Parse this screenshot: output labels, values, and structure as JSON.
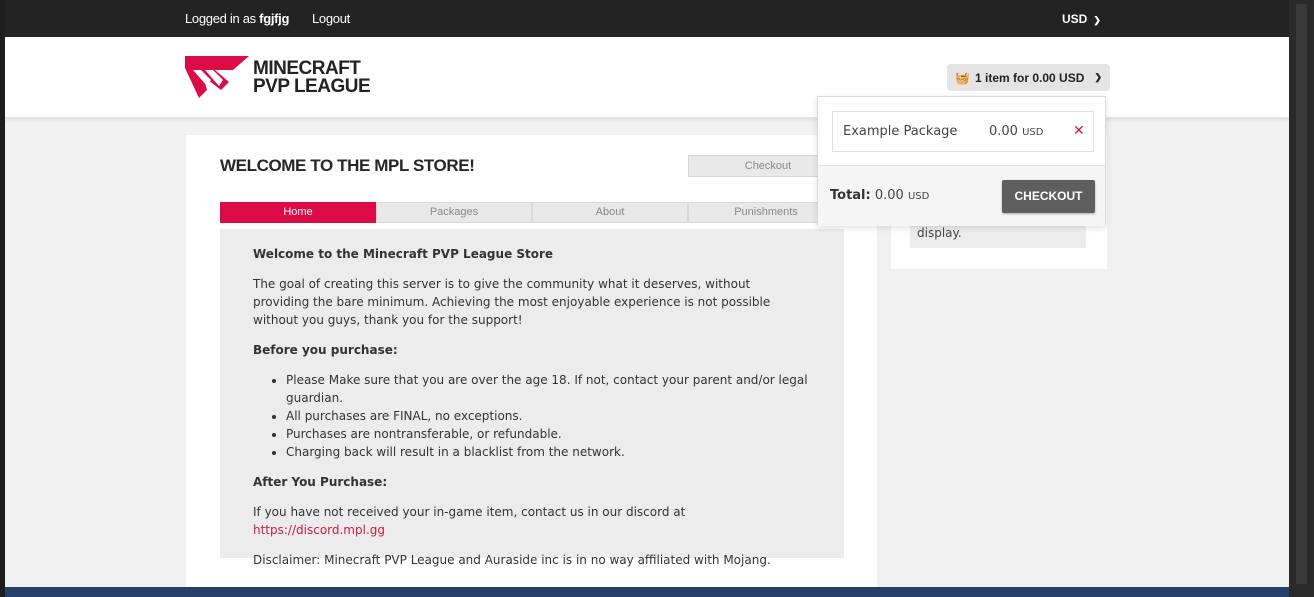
{
  "topbar": {
    "logged_in_prefix": "Logged in as",
    "username": "fgjfjg",
    "logout": "Logout",
    "currency": "USD"
  },
  "header": {
    "logo_line1": "MINECRAFT",
    "logo_line2": "PVP LEAGUE",
    "cart_button": "1 item for 0.00 USD"
  },
  "main": {
    "title": "WELCOME TO THE MPL STORE!",
    "checkout_button": "Checkout",
    "tabs": [
      {
        "label": "Home"
      },
      {
        "label": "Packages"
      },
      {
        "label": "About"
      },
      {
        "label": "Punishments"
      }
    ],
    "content": {
      "heading": "Welcome to the Minecraft PVP League Store",
      "intro_line1": "The goal of creating this server is to give the community what it deserves, without",
      "intro_line2": "providing the bare minimum. Achieving the most enjoyable experience is not possible without you guys, thank you for the support!",
      "before_heading": "Before you purchase:",
      "rules": [
        "Please Make sure that you are over the age 18. If not, contact your parent and/or legal guardian.",
        "All purchases are FINAL, no exceptions.",
        "Purchases are nontransferable, or refundable.",
        "Charging back will result in a blacklist from the network."
      ],
      "after_heading": "After You Purchase:",
      "after_text": "If you have not received your in-game item, contact us in our discord at",
      "discord_link": "https://discord.mpl.gg",
      "disclaimer": "Disclaimer: Minecraft PVP League and Auraside inc is in no way affiliated with Mojang."
    }
  },
  "sidebar": {
    "text": "display."
  },
  "cart_dropdown": {
    "item_name": "Example Package",
    "item_price": "0.00",
    "item_currency": "USD",
    "total_label": "Total:",
    "total_value": "0.00",
    "total_currency": "USD",
    "checkout": "CHECKOUT"
  },
  "colors": {
    "accent": "#dc0a45",
    "topbar": "#232323",
    "footer": "#263f6b"
  }
}
